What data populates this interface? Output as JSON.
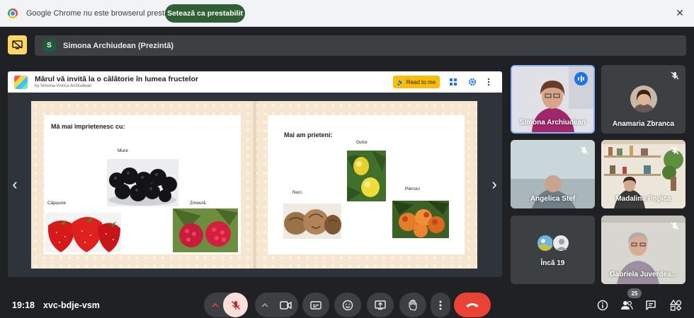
{
  "infobar": {
    "message": "Google Chrome nu este browserul prestabilit",
    "set_default_label": "Setează ca prestabilit",
    "close_icon": "close-icon"
  },
  "presenter": {
    "avatar_letter": "S",
    "name": "Simona Archiudean (Prezintă)"
  },
  "book": {
    "title": "Mărul vă invită la o călătorie în lumea fructelor",
    "author": "by Simona-Viorica Archiudean",
    "read_label": "Read to me",
    "left_page": {
      "heading": "Mă mai împrietenesc cu:",
      "fruits": [
        "Mure",
        "Căpșune",
        "Zmeură"
      ]
    },
    "right_page": {
      "heading": "Mai am prieteni:",
      "fruits": [
        "Gutui",
        "Nuci",
        "Piersici"
      ]
    }
  },
  "participants": [
    {
      "name": "Simona Archiudean",
      "speaking": true
    },
    {
      "name": "Anamaria Zbranca",
      "muted": true
    },
    {
      "name": "Angelica Stef",
      "muted": true
    },
    {
      "name": "Madalina Popica",
      "muted": true
    },
    {
      "name": "Încă 19"
    },
    {
      "name": "Gabriela Juverdea...",
      "muted": true
    }
  ],
  "bottom": {
    "time": "19:18",
    "meeting_code": "xvc-bdje-vsm",
    "participants_badge": "25"
  },
  "colors": {
    "background": "#202124",
    "accent_blue": "#1a73e8",
    "end_call_red": "#ea4335",
    "mic_off_red": "#f9dedc",
    "present_yellow": "#fdd663",
    "default_button_green": "#2f5f34"
  }
}
